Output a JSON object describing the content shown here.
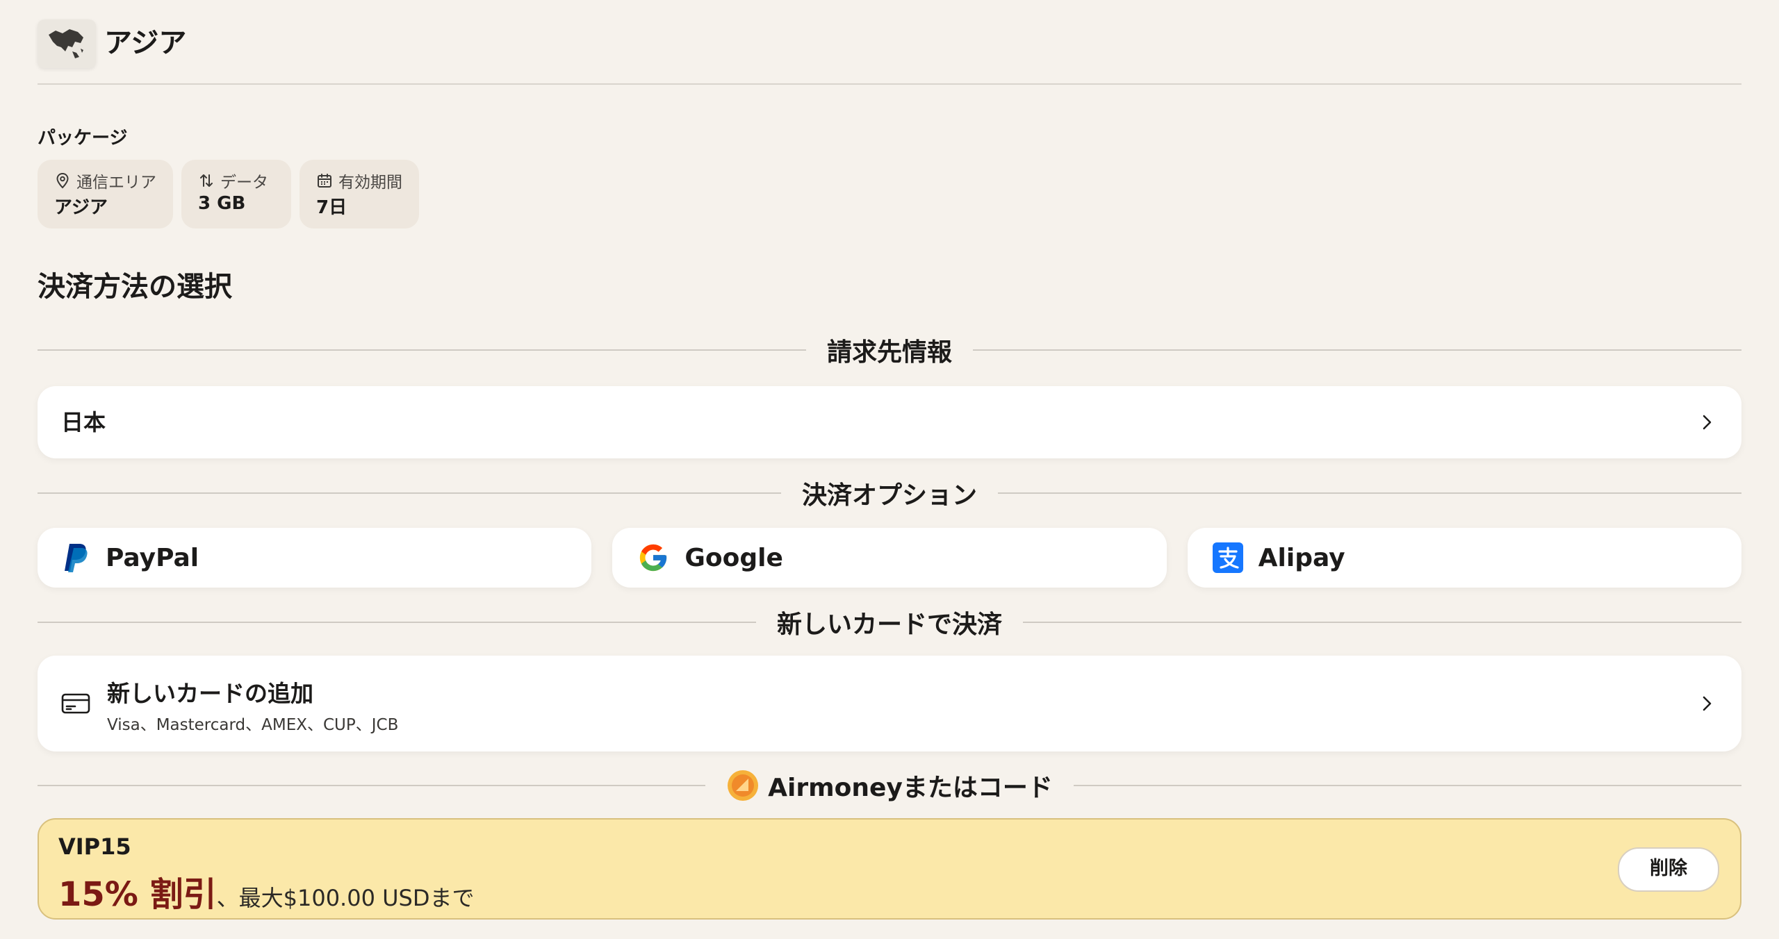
{
  "region": {
    "title": "アジア",
    "thumb_icon": "asia-map-icon"
  },
  "package": {
    "label": "パッケージ",
    "chips": [
      {
        "icon": "location-pin-icon",
        "label": "通信エリア",
        "value": "アジア"
      },
      {
        "icon": "data-transfer-icon",
        "label": "データ",
        "value": "3 GB"
      },
      {
        "icon": "calendar-icon",
        "label": "有効期間",
        "value": "7日"
      }
    ]
  },
  "payment": {
    "title": "決済方法の選択",
    "billing_divider": "請求先情報",
    "country": "日本",
    "options_divider": "決済オプション",
    "options": [
      {
        "label": "PayPal",
        "icon": "paypal-icon"
      },
      {
        "label": "Google",
        "icon": "google-icon"
      },
      {
        "label": "Alipay",
        "icon": "alipay-icon"
      }
    ],
    "new_card_divider": "新しいカードで決済",
    "new_card": {
      "title": "新しいカードの追加",
      "subtitle": "Visa、Mastercard、AMEX、CUP、JCB"
    },
    "airmoney_divider": "Airmoneyまたはコード",
    "promo": {
      "code": "VIP15",
      "discount": "15% 割引",
      "note": "、最大$100.00 USDまで",
      "remove_label": "削除"
    }
  },
  "colors": {
    "background": "#f6f2ec",
    "promo_bg": "#fbe8a9",
    "discount_text": "#7b1a14",
    "paypal": "#003087",
    "alipay": "#1677ff"
  }
}
